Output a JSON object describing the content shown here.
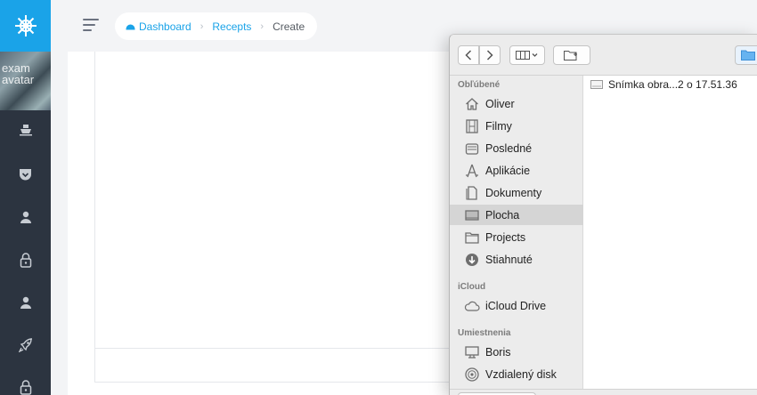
{
  "sidebar": {
    "logo_icon": "ship-wheel-icon",
    "avatar_lines": [
      "exam",
      "avatar"
    ],
    "icons": [
      "boat-icon",
      "pocket-icon",
      "user-icon",
      "lock-icon",
      "user-icon",
      "rocket-icon",
      "lock-icon"
    ],
    "accent": "#1aa3e8",
    "bg": "#2c3440"
  },
  "breadcrumb": {
    "home": "Dashboard",
    "section": "Recepts",
    "current": "Create"
  },
  "dialog": {
    "toolbar_icons": [
      "chevron-left-icon",
      "chevron-right-icon",
      "column-view-icon",
      "new-folder-icon",
      "folder-icon"
    ],
    "sections": {
      "favorites": "Obľúbené",
      "icloud": "iCloud",
      "locations": "Umiestnenia"
    },
    "favorites": [
      {
        "label": "Oliver",
        "icon": "home-icon"
      },
      {
        "label": "Filmy",
        "icon": "film-icon"
      },
      {
        "label": "Posledné",
        "icon": "recents-icon"
      },
      {
        "label": "Aplikácie",
        "icon": "applications-icon"
      },
      {
        "label": "Dokumenty",
        "icon": "document-icon"
      },
      {
        "label": "Plocha",
        "icon": "desktop-icon"
      },
      {
        "label": "Projects",
        "icon": "folder-icon"
      },
      {
        "label": "Stiahnuté",
        "icon": "download-icon"
      }
    ],
    "icloud_items": [
      {
        "label": "iCloud Drive",
        "icon": "cloud-icon"
      }
    ],
    "location_items": [
      {
        "label": "Boris",
        "icon": "computer-icon"
      },
      {
        "label": "Vzdialený disk",
        "icon": "disc-icon"
      }
    ],
    "selected_item": "Plocha",
    "files": [
      {
        "name": "Snímka obra...2 o 17.51.36",
        "icon": "screenshot-file-icon"
      }
    ]
  }
}
